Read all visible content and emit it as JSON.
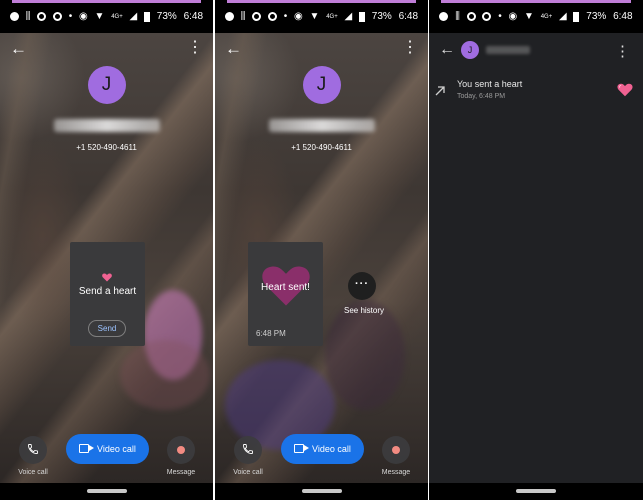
{
  "status_bar": {
    "battery": "73%",
    "time": "6:48",
    "network": "4G+"
  },
  "contact": {
    "initial": "J",
    "phone": "+1 520-490-4611"
  },
  "panel1": {
    "card_title": "Send a heart",
    "send_label": "Send"
  },
  "panel2": {
    "card_title": "Heart sent!",
    "card_time": "6:48 PM",
    "history_label": "See history"
  },
  "actions": {
    "voice_label": "Voice call",
    "video_label": "Video call",
    "message_label": "Message"
  },
  "history": {
    "event_title": "You sent a heart",
    "event_time": "Today, 6:48 PM"
  },
  "colors": {
    "accent_blue": "#1a73e8",
    "avatar_purple": "#a06ce0",
    "heart_pink": "#f06292",
    "dark_bg": "#202124"
  },
  "icons": [
    "back-arrow-icon",
    "more-vert-icon",
    "heart-icon",
    "phone-icon",
    "videocam-icon",
    "message-dot-icon",
    "outgoing-arrow-icon"
  ]
}
